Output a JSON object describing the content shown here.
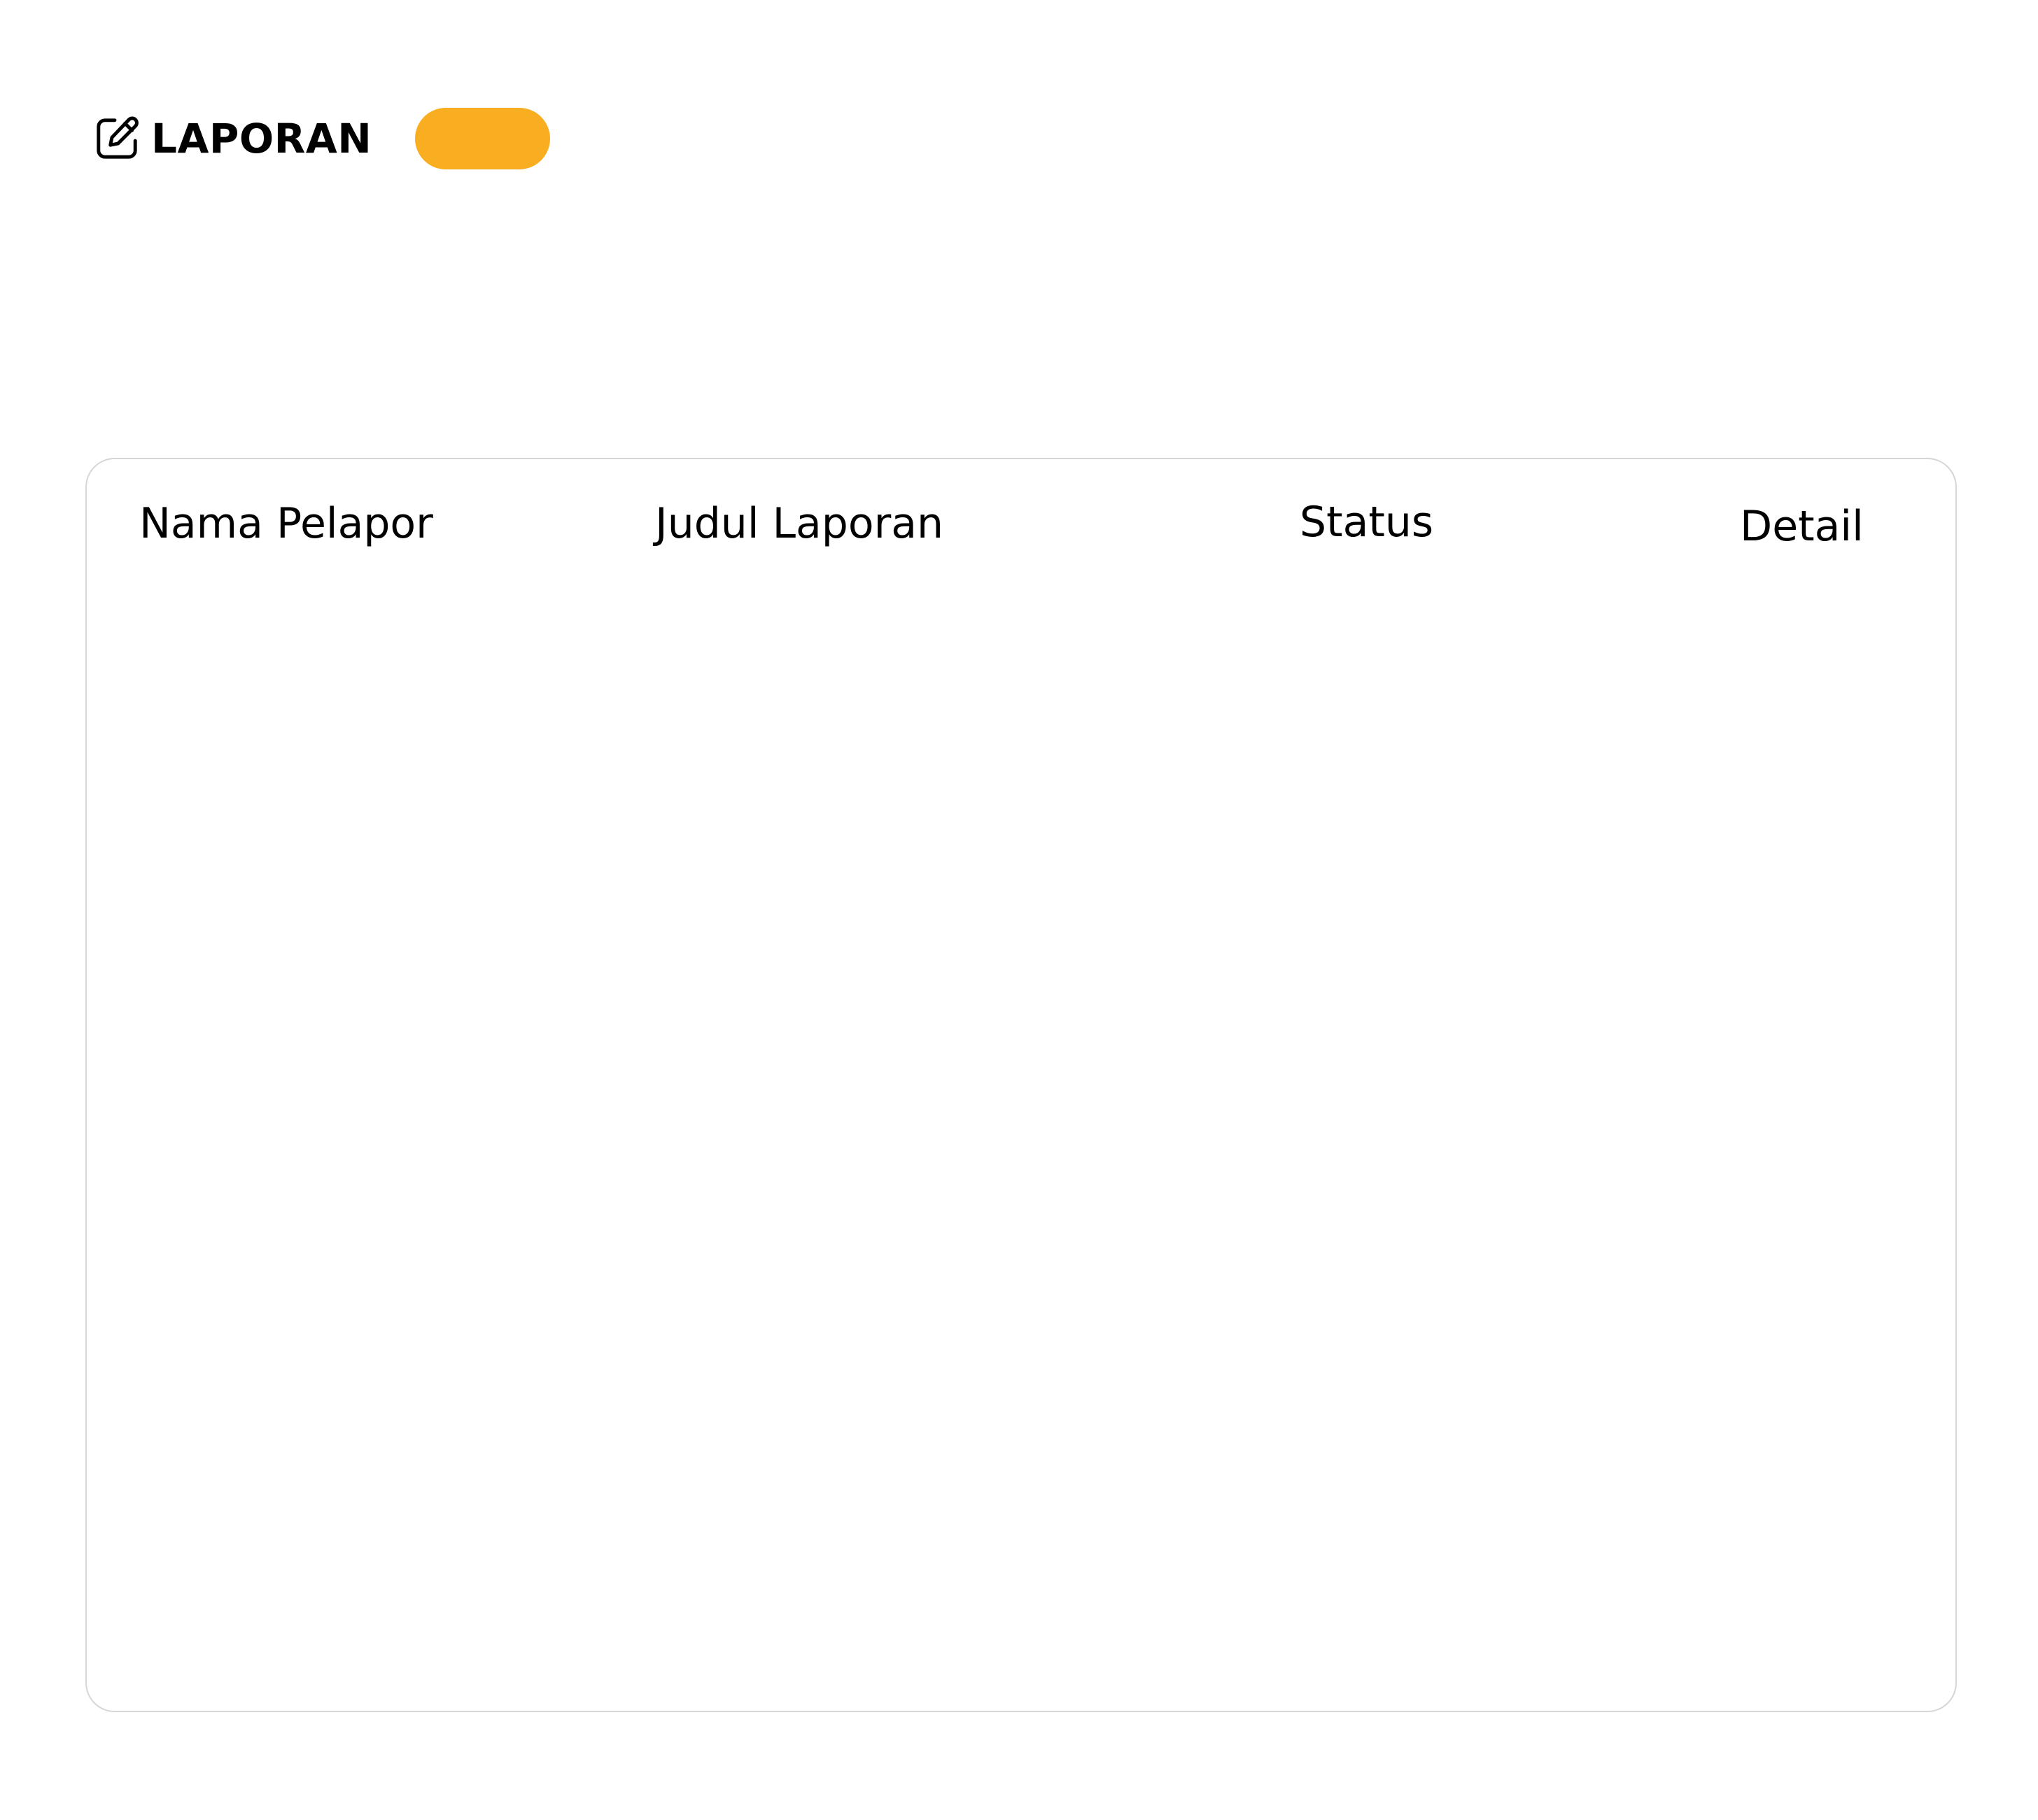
{
  "header": {
    "icon": "edit-icon",
    "title": "LAPORAN",
    "badge_color": "#F9AD21",
    "badge_label": ""
  },
  "table": {
    "columns": [
      "Nama Pelapor",
      "Judul Laporan",
      "Status",
      "Detail"
    ],
    "rows": []
  },
  "colors": {
    "accent": "#F9AD21",
    "card_border": "#d6d6d6",
    "background": "#ffffff",
    "text": "#000000"
  }
}
